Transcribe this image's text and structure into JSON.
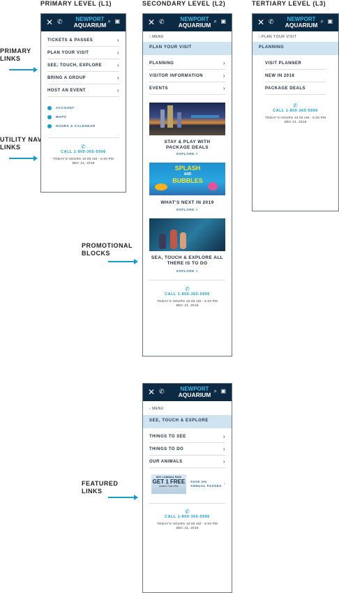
{
  "columns": {
    "l1": "PRIMARY LEVEL (L1)",
    "l2": "SECONDARY LEVEL (L2)",
    "l3": "TERTIARY LEVEL (L3)"
  },
  "annotations": {
    "primary_links": "PRIMARY LINKS",
    "utility_nav_links": "UTILITY NAV LINKS",
    "promotional_blocks": "PROMOTIONAL BLOCKS",
    "featured_links": "FEATURED LINKS"
  },
  "logo": {
    "line1": "NEWPORT",
    "line2": "AQUARIUM"
  },
  "topbar_icons": [
    "close-icon",
    "phone-icon",
    "search-icon",
    "cart-icon"
  ],
  "contact": {
    "call": "CALL 1-800-365-5996",
    "hours": "TODAY'S HOURS 10:00 AM - 6:00 PM",
    "date": "DEC 21, 2018"
  },
  "l1": {
    "items": [
      "TICKETS & PASSES",
      "PLAN YOUR VISIT",
      "SEE, TOUCH, EXPLORE",
      "BRING A GROUP",
      "HOST AN EVENT"
    ],
    "utility": [
      "ACCOUNT",
      "MAPS",
      "HOURS & CALENDAR"
    ]
  },
  "l2": {
    "back": "MENU",
    "section": "PLAN YOUR VISIT",
    "items": [
      "PLANNING",
      "VISITOR INFORMATION",
      "EVENTS"
    ],
    "promos": [
      {
        "title_1": "STAY & PLAY WITH",
        "title_2": "PACKAGE DEALS",
        "cta": "EXPLORE >"
      },
      {
        "title_1": "WHAT'S NEXT IN 2019",
        "title_2": "",
        "cta": "EXPLORE >",
        "art_1": "SPLASH",
        "art_2": "AND",
        "art_3": "BUBBLES"
      },
      {
        "title_1": "SEA, TOUCH & EXPLORE ALL",
        "title_2": "THERE IS TO DO",
        "cta": "EXPLORE >"
      }
    ]
  },
  "l3": {
    "back": "PLAN YOUR VISIT",
    "section": "PLANNING",
    "items": [
      "VISIT PLANNER",
      "NEW IN 2018",
      "PACKAGE DEALS"
    ]
  },
  "l2b": {
    "back": "MENU",
    "section": "SEE, TOUCH & EXPLORE",
    "items": [
      "THINGS TO SEE",
      "THINGS TO DO",
      "OUR ANIMALS"
    ],
    "featured": {
      "ad_1": "BUY 1 ANNUAL PASS",
      "ad_2": "GET 1 FREE",
      "ad_3": "Limited Time Offer",
      "label_1": "SAVE ON",
      "label_2": "ANNUAL PASSES"
    }
  },
  "colors": {
    "nav_bg": "#0c2a44",
    "accent": "#1a9bc6",
    "section_bg": "#cfe3f1"
  }
}
